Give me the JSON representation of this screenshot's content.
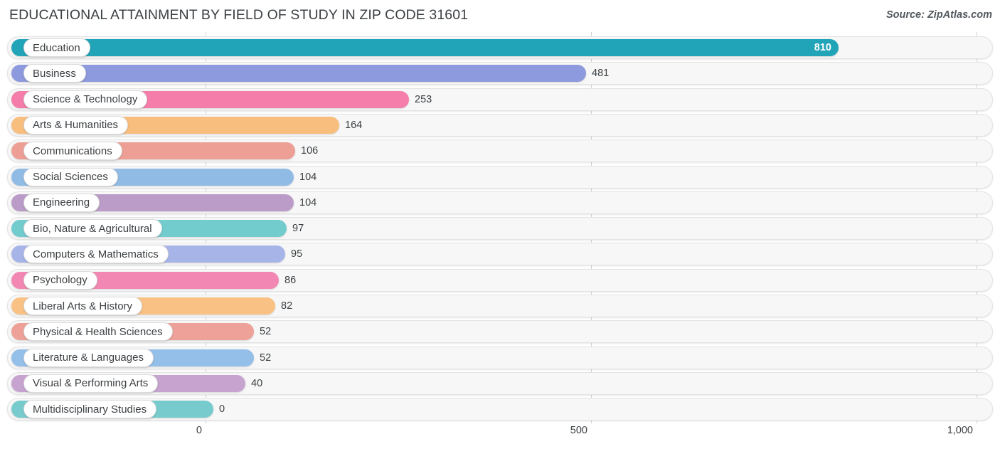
{
  "header": {
    "title": "EDUCATIONAL ATTAINMENT BY FIELD OF STUDY IN ZIP CODE 31601",
    "source": "Source: ZipAtlas.com"
  },
  "axis": {
    "ticks": [
      {
        "label": "0",
        "value": 0
      },
      {
        "label": "500",
        "value": 500
      },
      {
        "label": "1,000",
        "value": 1000
      }
    ]
  },
  "chart_data": {
    "type": "bar",
    "orientation": "horizontal",
    "title": "EDUCATIONAL ATTAINMENT BY FIELD OF STUDY IN ZIP CODE 31601",
    "subtitle": "Source: ZipAtlas.com",
    "xlabel": "",
    "ylabel": "",
    "xlim": [
      0,
      1000
    ],
    "xticks": [
      0,
      500,
      1000
    ],
    "xticklabels": [
      "0",
      "500",
      "1,000"
    ],
    "grid": true,
    "legend": false,
    "categories": [
      "Education",
      "Business",
      "Science & Technology",
      "Arts & Humanities",
      "Communications",
      "Social Sciences",
      "Engineering",
      "Bio, Nature & Agricultural",
      "Computers & Mathematics",
      "Psychology",
      "Liberal Arts & History",
      "Physical & Health Sciences",
      "Literature & Languages",
      "Visual & Performing Arts",
      "Multidisciplinary Studies"
    ],
    "values": [
      810,
      481,
      253,
      164,
      106,
      104,
      104,
      97,
      95,
      86,
      82,
      52,
      52,
      40,
      0
    ],
    "value_labels": [
      "810",
      "481",
      "253",
      "164",
      "106",
      "104",
      "104",
      "97",
      "95",
      "86",
      "82",
      "52",
      "52",
      "40",
      "0"
    ],
    "colors": [
      "#21a4b8",
      "#8e9ade",
      "#f47daa",
      "#f8be7e",
      "#ed9f95",
      "#8fbbe5",
      "#bb9cc8",
      "#72cbcd",
      "#a7b4e8",
      "#f387b3",
      "#f9c184",
      "#eda198",
      "#93bfe9",
      "#c7a3cf",
      "#78cbcd"
    ]
  },
  "rows": [
    {
      "label": "Education",
      "value": 810,
      "value_label": "810",
      "color": "#21a4b8",
      "bar_end": 1179,
      "inside": true
    },
    {
      "label": "Business",
      "value": 481,
      "value_label": "481",
      "color": "#8e9ade",
      "bar_end": 824,
      "inside": false
    },
    {
      "label": "Science & Technology",
      "value": 253,
      "value_label": "253",
      "color": "#f47daa",
      "bar_end": 575,
      "inside": false
    },
    {
      "label": "Arts & Humanities",
      "value": 164,
      "value_label": "164",
      "color": "#f8be7e",
      "bar_end": 477,
      "inside": false
    },
    {
      "label": "Communications",
      "value": 106,
      "value_label": "106",
      "color": "#ed9f95",
      "bar_end": 415,
      "inside": false
    },
    {
      "label": "Social Sciences",
      "value": 104,
      "value_label": "104",
      "color": "#8fbbe5",
      "bar_end": 413,
      "inside": false
    },
    {
      "label": "Engineering",
      "value": 104,
      "value_label": "104",
      "color": "#bb9cc8",
      "bar_end": 413,
      "inside": false
    },
    {
      "label": "Bio, Nature & Agricultural",
      "value": 97,
      "value_label": "97",
      "color": "#72cbcd",
      "bar_end": 403,
      "inside": false
    },
    {
      "label": "Computers & Mathematics",
      "value": 95,
      "value_label": "95",
      "color": "#a7b4e8",
      "bar_end": 401,
      "inside": false
    },
    {
      "label": "Psychology",
      "value": 86,
      "value_label": "86",
      "color": "#f387b3",
      "bar_end": 392,
      "inside": false
    },
    {
      "label": "Liberal Arts & History",
      "value": 82,
      "value_label": "82",
      "color": "#f9c184",
      "bar_end": 387,
      "inside": false
    },
    {
      "label": "Physical & Health Sciences",
      "value": 52,
      "value_label": "52",
      "color": "#eda198",
      "bar_end": 357,
      "inside": false
    },
    {
      "label": "Literature & Languages",
      "value": 52,
      "value_label": "52",
      "color": "#93bfe9",
      "bar_end": 357,
      "inside": false
    },
    {
      "label": "Visual & Performing Arts",
      "value": 40,
      "value_label": "40",
      "color": "#c7a3cf",
      "bar_end": 345,
      "inside": false
    },
    {
      "label": "Multidisciplinary Studies",
      "value": 0,
      "value_label": "0",
      "color": "#78cbcd",
      "bar_end": 300,
      "inside": false
    }
  ],
  "geometry": {
    "x_zero": 289,
    "x_per_unit": 1.084,
    "row_pitch": 36.3,
    "row_top_0": 6
  }
}
